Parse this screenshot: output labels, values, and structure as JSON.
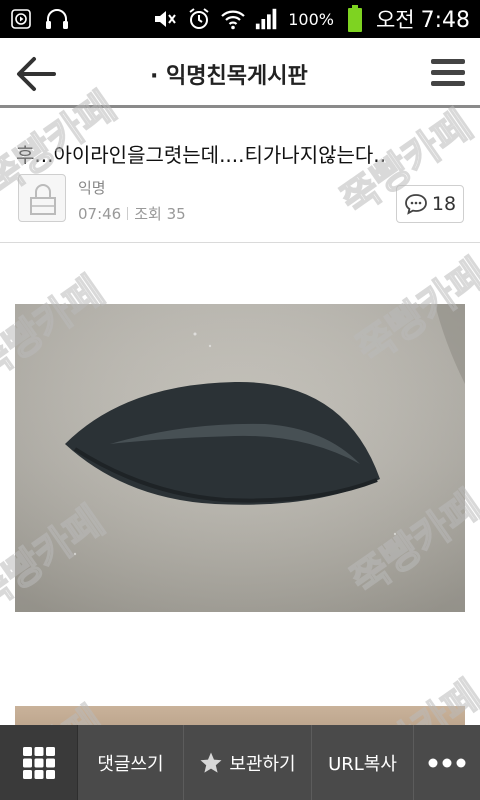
{
  "status_bar": {
    "battery_percent": "100%",
    "ampm": "오전",
    "time": "7:48"
  },
  "header": {
    "board_title": "· 익명친목게시판"
  },
  "post": {
    "title": "후...아이라인을그렷는데....티가나지않는다..",
    "author": "익명",
    "time": "07:46",
    "views": "조회 35",
    "comment_count": "18"
  },
  "bottom_bar": {
    "comment_label": "댓글쓰기",
    "save_label": "보관하기",
    "url_label": "URL복사"
  },
  "watermark_text": "쭉빵카페",
  "icons": {
    "back": "back-arrow-icon",
    "menu": "hamburger-menu-icon",
    "lock": "lock-icon",
    "comment": "speech-bubble-icon",
    "grid": "grid-icon",
    "star": "star-icon",
    "more": "more-dots-icon"
  },
  "colors": {
    "status_bar": "#000000",
    "bottom_bar": "#4a4a4a",
    "battery": "#7ed321"
  }
}
